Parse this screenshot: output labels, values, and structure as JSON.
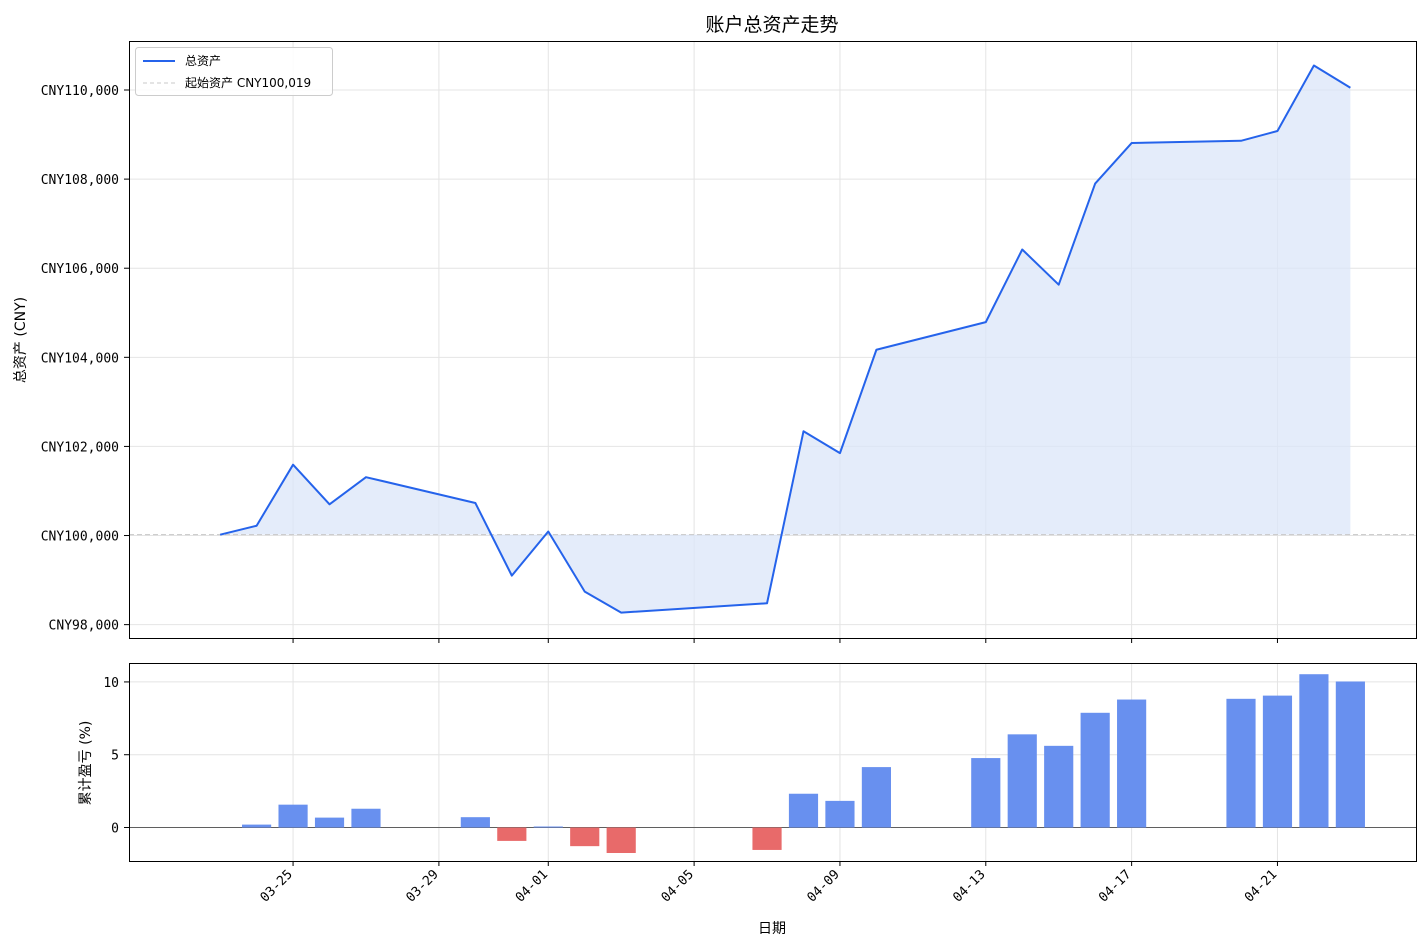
{
  "chart_data": [
    {
      "type": "line",
      "title": "账户总资产走势",
      "xlabel": "",
      "ylabel": "总资产 (CNY)",
      "ylim": [
        97700,
        111100
      ],
      "grid": true,
      "legend_position": "top-left",
      "legend": [
        {
          "label": "总资产",
          "style": "solid",
          "color": "#2563eb"
        },
        {
          "label": "起始资产 CNY100,019",
          "style": "dashed",
          "color": "#c8c8c8"
        }
      ],
      "yticks": [
        {
          "value": 98000,
          "label": "CNY98,000"
        },
        {
          "value": 100000,
          "label": "CNY100,000"
        },
        {
          "value": 102000,
          "label": "CNY102,000"
        },
        {
          "value": 104000,
          "label": "CNY104,000"
        },
        {
          "value": 106000,
          "label": "CNY106,000"
        },
        {
          "value": 108000,
          "label": "CNY108,000"
        },
        {
          "value": 110000,
          "label": "CNY110,000"
        }
      ],
      "baseline": 100019,
      "fill_color": "#dbe6f8",
      "series": [
        {
          "name": "总资产",
          "color": "#2563eb",
          "points": [
            {
              "x": "03-23",
              "y": 100019
            },
            {
              "x": "03-24",
              "y": 100220
            },
            {
              "x": "03-25",
              "y": 101590
            },
            {
              "x": "03-26",
              "y": 100700
            },
            {
              "x": "03-27",
              "y": 101310
            },
            {
              "x": "03-30",
              "y": 100730
            },
            {
              "x": "03-31",
              "y": 99100
            },
            {
              "x": "04-01",
              "y": 100090
            },
            {
              "x": "04-02",
              "y": 98740
            },
            {
              "x": "04-03",
              "y": 98270
            },
            {
              "x": "04-07",
              "y": 98480
            },
            {
              "x": "04-08",
              "y": 102340
            },
            {
              "x": "04-09",
              "y": 101850
            },
            {
              "x": "04-10",
              "y": 104170
            },
            {
              "x": "04-13",
              "y": 104790
            },
            {
              "x": "04-14",
              "y": 106420
            },
            {
              "x": "04-15",
              "y": 105630
            },
            {
              "x": "04-16",
              "y": 107900
            },
            {
              "x": "04-17",
              "y": 108810
            },
            {
              "x": "04-20",
              "y": 108860
            },
            {
              "x": "04-21",
              "y": 109080
            },
            {
              "x": "04-22",
              "y": 110550
            },
            {
              "x": "04-23",
              "y": 110050
            }
          ]
        }
      ]
    },
    {
      "type": "bar",
      "title": "",
      "xlabel": "日期",
      "ylabel": "累计盈亏 (%)",
      "ylim": [
        -2.3,
        11.3
      ],
      "grid": true,
      "yticks": [
        {
          "value": 0,
          "label": "0"
        },
        {
          "value": 5,
          "label": "5"
        },
        {
          "value": 10,
          "label": "10"
        }
      ],
      "xticks": [
        "03-25",
        "03-29",
        "04-01",
        "04-05",
        "04-09",
        "04-13",
        "04-17",
        "04-21"
      ],
      "positive_color": "#6890ef",
      "negative_color": "#e86a6a",
      "series": [
        {
          "name": "累计盈亏",
          "points": [
            {
              "x": "03-23",
              "y": 0.0
            },
            {
              "x": "03-24",
              "y": 0.2
            },
            {
              "x": "03-25",
              "y": 1.57
            },
            {
              "x": "03-26",
              "y": 0.68
            },
            {
              "x": "03-27",
              "y": 1.29
            },
            {
              "x": "03-30",
              "y": 0.71
            },
            {
              "x": "03-31",
              "y": -0.92
            },
            {
              "x": "04-01",
              "y": 0.07
            },
            {
              "x": "04-02",
              "y": -1.28
            },
            {
              "x": "04-03",
              "y": -1.75
            },
            {
              "x": "04-07",
              "y": -1.54
            },
            {
              "x": "04-08",
              "y": 2.32
            },
            {
              "x": "04-09",
              "y": 1.83
            },
            {
              "x": "04-10",
              "y": 4.15
            },
            {
              "x": "04-13",
              "y": 4.77
            },
            {
              "x": "04-14",
              "y": 6.4
            },
            {
              "x": "04-15",
              "y": 5.61
            },
            {
              "x": "04-16",
              "y": 7.88
            },
            {
              "x": "04-17",
              "y": 8.79
            },
            {
              "x": "04-20",
              "y": 8.84
            },
            {
              "x": "04-21",
              "y": 9.06
            },
            {
              "x": "04-22",
              "y": 10.53
            },
            {
              "x": "04-23",
              "y": 10.03
            }
          ]
        }
      ]
    }
  ]
}
